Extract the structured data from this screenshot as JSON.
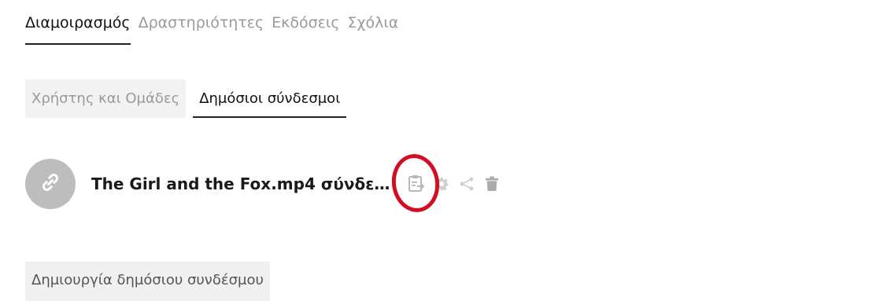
{
  "top_tabs": [
    {
      "label": "Διαμοιρασμός",
      "active": true
    },
    {
      "label": "Δραστηριότητες",
      "active": false
    },
    {
      "label": "Εκδόσεις",
      "active": false
    },
    {
      "label": "Σχόλια",
      "active": false
    }
  ],
  "sub_tabs": [
    {
      "label": "Χρήστης και Ομάδες",
      "active": false
    },
    {
      "label": "Δημόσιοι σύνδεσμοι",
      "active": true
    }
  ],
  "link": {
    "name": "The Girl and the Fox.mp4 σύνδε…",
    "icon": "link-icon",
    "actions": [
      "copy-link-icon",
      "settings-icon",
      "share-icon",
      "delete-icon"
    ]
  },
  "create_button_label": "Δημιουργία δημόσιου συνδέσμου",
  "colors": {
    "highlight": "#d10f24",
    "avatar": "#bdbdbd",
    "icon_gray": "#c4c4c4"
  }
}
